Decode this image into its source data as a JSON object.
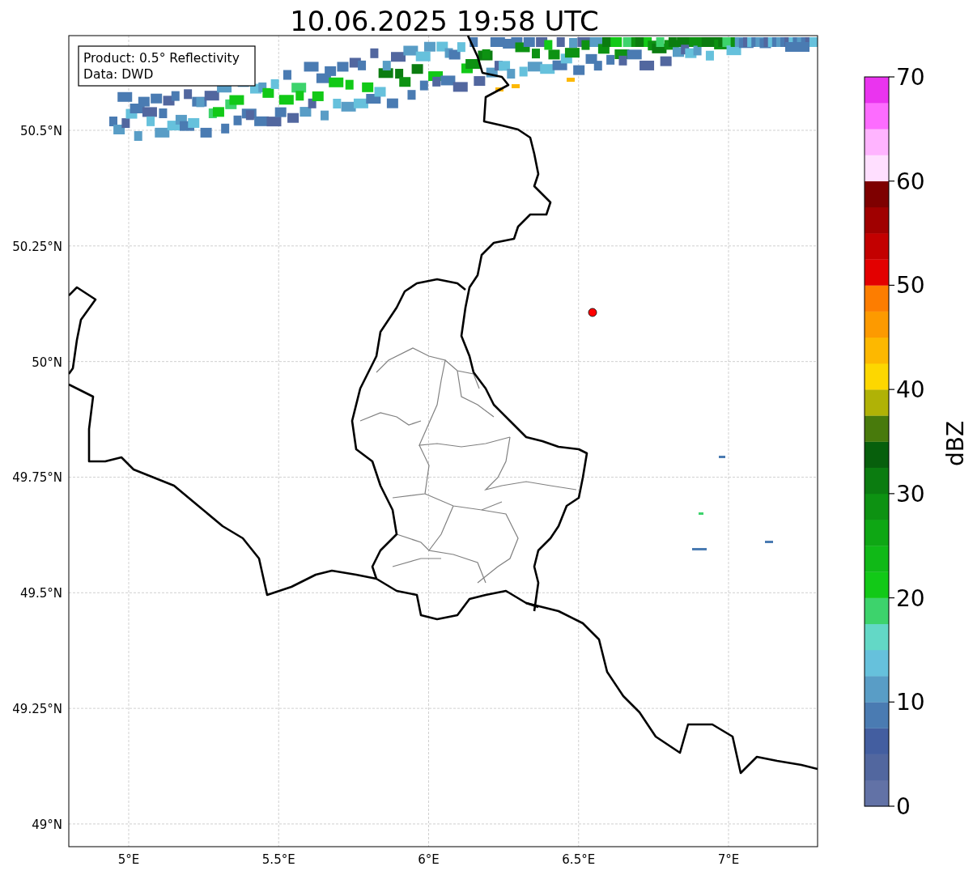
{
  "title": "10.06.2025 19:58 UTC",
  "legend": [
    "Product: 0.5° Reflectivity",
    "Data: DWD"
  ],
  "x_ticks": [
    "5°E",
    "5.5°E",
    "6°E",
    "6.5°E",
    "7°E"
  ],
  "y_ticks": [
    "50.5°N",
    "50.25°N",
    "50°N",
    "49.75°N",
    "49.5°N",
    "49.25°N",
    "49°N"
  ],
  "colorbar": {
    "label": "dBZ",
    "ticks": [
      "70",
      "60",
      "50",
      "40",
      "30",
      "20",
      "10",
      "0"
    ],
    "segments": [
      {
        "color": "#6272a6"
      },
      {
        "color": "#52679f"
      },
      {
        "color": "#435ea0"
      },
      {
        "color": "#4a7bb2"
      },
      {
        "color": "#599dc6"
      },
      {
        "color": "#66c1dc"
      },
      {
        "color": "#63d8c6"
      },
      {
        "color": "#3dd36c"
      },
      {
        "color": "#12c917"
      },
      {
        "color": "#10b917"
      },
      {
        "color": "#0ea714"
      },
      {
        "color": "#0d9212"
      },
      {
        "color": "#0b7c10"
      },
      {
        "color": "#075f0c"
      },
      {
        "color": "#487a0c"
      },
      {
        "color": "#b0b206"
      },
      {
        "color": "#fdd700"
      },
      {
        "color": "#fdb800"
      },
      {
        "color": "#fd9a00"
      },
      {
        "color": "#fd7d00"
      },
      {
        "color": "#e30000"
      },
      {
        "color": "#c30000"
      },
      {
        "color": "#a00000"
      },
      {
        "color": "#7e0000"
      },
      {
        "color": "#ffdfff"
      },
      {
        "color": "#ffb4ff"
      },
      {
        "color": "#fd6cff"
      },
      {
        "color": "#ea34ef"
      }
    ]
  }
}
